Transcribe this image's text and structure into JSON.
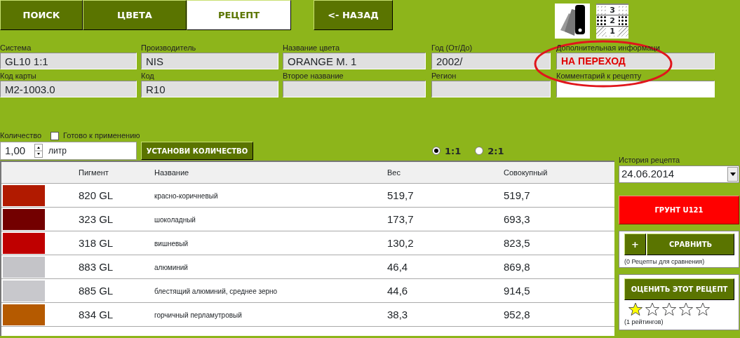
{
  "tabs": [
    {
      "label": "ПОИСК",
      "selected": false
    },
    {
      "label": "ЦВЕТА",
      "selected": false
    },
    {
      "label": "РЕЦЕПТ",
      "selected": true
    }
  ],
  "back_button": "<- НАЗАД",
  "layer_labels": [
    "3",
    "2",
    "1"
  ],
  "fields": [
    [
      {
        "label": "Система",
        "value": "GL10 1:1",
        "readonly": true,
        "highlight": false
      },
      {
        "label": "Производитель",
        "value": "NIS",
        "readonly": true,
        "highlight": false
      },
      {
        "label": "Название цвета",
        "value": "ORANGE M. 1",
        "readonly": true,
        "highlight": false
      },
      {
        "label": "Год (От/До)",
        "value": "2002/",
        "readonly": true,
        "highlight": false
      },
      {
        "label": "Дополнительная информаци",
        "value": "НА ПЕРЕХОД",
        "readonly": true,
        "highlight": true
      }
    ],
    [
      {
        "label": "Код карты",
        "value": "M2-1003.0",
        "readonly": true,
        "highlight": false
      },
      {
        "label": "Код",
        "value": "R10",
        "readonly": true,
        "highlight": false
      },
      {
        "label": "Второе название",
        "readonly": true
      },
      {
        "label": "Регион",
        "readonly": true
      },
      {
        "label": "Комментарий к рецепту",
        "readonly": false
      }
    ]
  ],
  "quantity": {
    "label": "Количество",
    "ready_label": "Готово к применению",
    "ready_checked": false,
    "value": "1,00",
    "unit": "литр",
    "set_button": "УСТАНОВИ КОЛИЧЕСТВО"
  },
  "ratios": [
    {
      "label": "1:1",
      "selected": true
    },
    {
      "label": "2:1",
      "selected": false
    }
  ],
  "table": {
    "columns": [
      "Пигмент",
      "Название",
      "Вес",
      "Совокупный"
    ],
    "rows": [
      {
        "color": "#b11a00",
        "pigment": "820 GL",
        "name": "красно-коричневый",
        "weight": "519,7",
        "total": "519,7"
      },
      {
        "color": "#730000",
        "pigment": "323 GL",
        "name": "шоколадный",
        "weight": "173,7",
        "total": "693,3"
      },
      {
        "color": "#bf0000",
        "pigment": "318 GL",
        "name": "вишневый",
        "weight": "130,2",
        "total": "823,5"
      },
      {
        "color": "#c4c4c8",
        "pigment": "883 GL",
        "name": "алюминий",
        "weight": "46,4",
        "total": "869,8"
      },
      {
        "color": "#c8c8cc",
        "pigment": "885 GL",
        "name": "блестящий алюминий, среднее зерно",
        "weight": "44,6",
        "total": "914,5"
      },
      {
        "color": "#b55a00",
        "pigment": "834 GL",
        "name": "горчичный перламутровый",
        "weight": "38,3",
        "total": "952,8"
      }
    ]
  },
  "history": {
    "label": "История рецепта",
    "value": "24.06.2014"
  },
  "primer_button": "ГРУНТ U121",
  "compare": {
    "add_button": "+",
    "button": "СРАВНИТЬ",
    "note": "(0 Рецепты для сравнения)"
  },
  "rating": {
    "button": "ОЦЕНИТЬ ЭТОТ РЕЦЕПТ",
    "stars": 1,
    "note": "(1 рейтингов)"
  }
}
